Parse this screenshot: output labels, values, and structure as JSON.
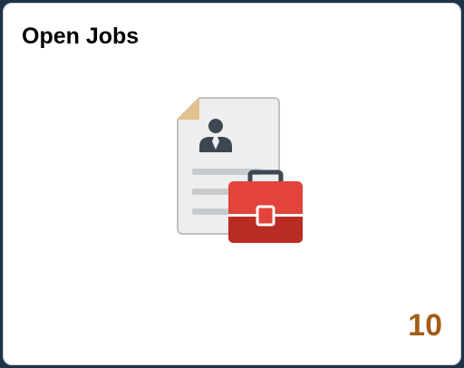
{
  "tile": {
    "title": "Open Jobs",
    "count": "10",
    "icon": "job-posting-briefcase-icon"
  },
  "colors": {
    "background": "#1f3446",
    "title": "#000000",
    "count": "#a35d17",
    "briefcase": "#e2433a",
    "document": "#eeeeee",
    "fold_corner": "#f5a020"
  }
}
